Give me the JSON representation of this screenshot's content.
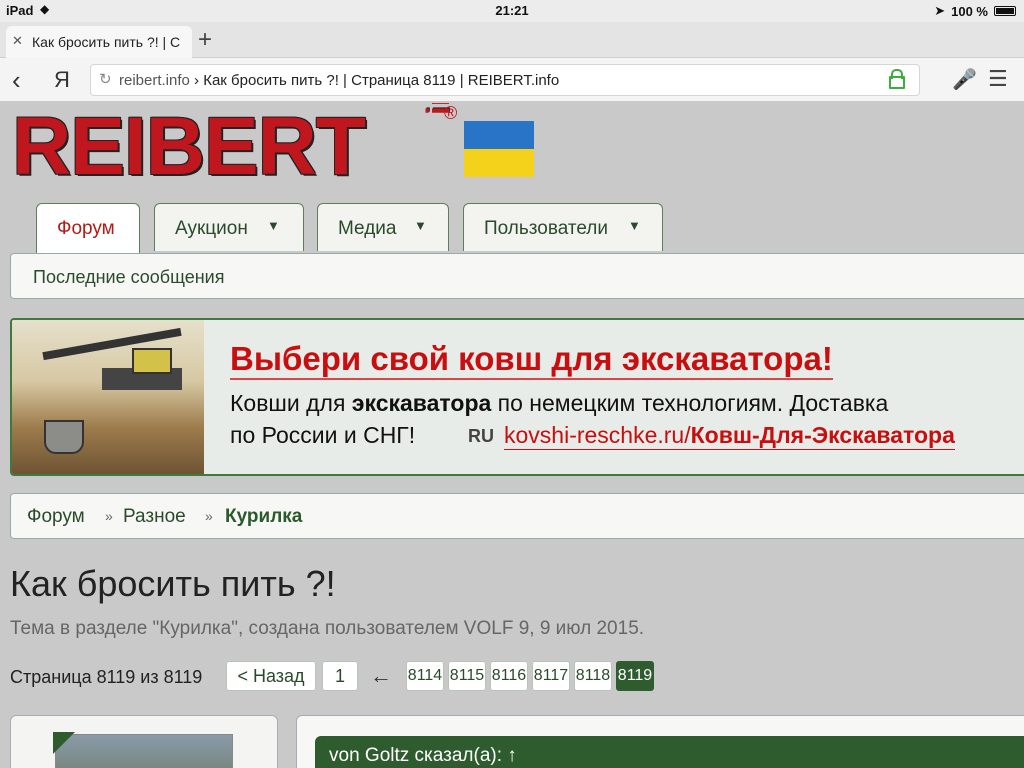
{
  "status_bar": {
    "device": "iPad",
    "time": "21:21",
    "battery": "100 %"
  },
  "browser": {
    "tab_title": "Как бросить пить ?! | С",
    "url_host": "reibert.info",
    "url_rest": " › Как бросить пить ?! | Страница 8119 | REIBERT.info",
    "yandex_label": "Я"
  },
  "site": {
    "logo_main": "REIBERT",
    "logo_info": "info",
    "logo_reg": "®"
  },
  "nav": {
    "tabs": [
      {
        "label": "Форум"
      },
      {
        "label": "Аукцион"
      },
      {
        "label": "Медиа"
      },
      {
        "label": "Пользователи"
      }
    ],
    "subnav_label": "Последние сообщения"
  },
  "ad": {
    "headline": "Выбери свой ковш для экскаватора!",
    "line2_pre": "Ковши для ",
    "line2_bold": "экскаватора",
    "line2_post": " по немецким технологиям. Доставка",
    "line3": "по России и СНГ!",
    "ru_icon": "RU",
    "link_domain": "kovshi-reschke.ru/",
    "link_path": "Ковш-Для-Экскаватора"
  },
  "breadcrumb": {
    "items": [
      "Форум",
      "Разное",
      "Курилка"
    ],
    "separator": "»"
  },
  "thread": {
    "title": "Как бросить пить ?!",
    "description": "Тема в разделе \"Курилка\", создана пользователем VOLF 9, 9 июл 2015."
  },
  "pagination": {
    "label": "Страница 8119 из 8119",
    "prev": "< Назад",
    "first": "1",
    "arrow": "←",
    "pages": [
      "8114",
      "8115",
      "8116",
      "8117",
      "8118",
      "8119"
    ],
    "current": "8119"
  },
  "post": {
    "quote_author": "von Goltz сказал(а): ↑"
  },
  "colors": {
    "brand_red": "#c0171f",
    "forum_green": "#2f5c2f",
    "link_green": "#2b4a2b",
    "ad_red": "#c80e0e"
  }
}
